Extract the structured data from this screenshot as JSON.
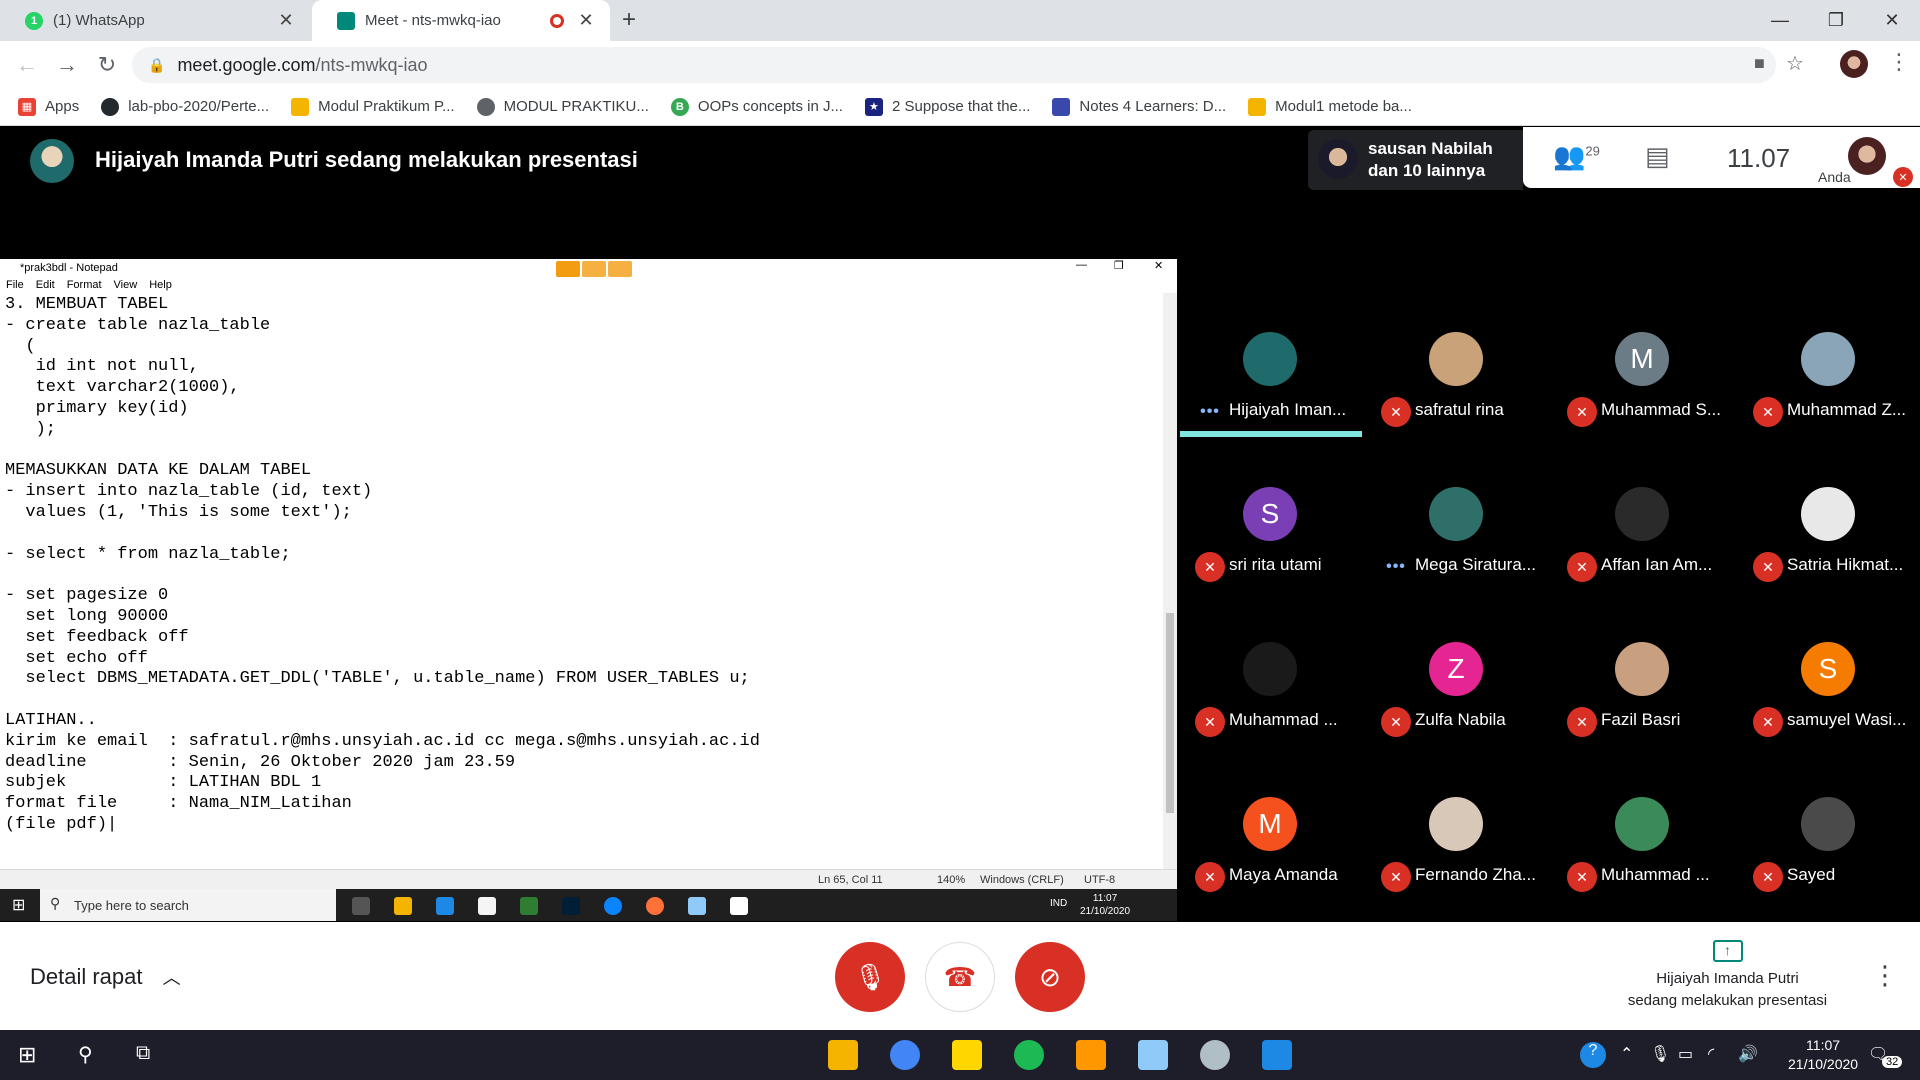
{
  "browser": {
    "tabs": [
      {
        "title": "(1) WhatsApp",
        "badge": "1",
        "active": false
      },
      {
        "title": "Meet - nts-mwkq-iao",
        "active": true
      }
    ],
    "new_tab": "+",
    "url_host": "meet.google.com",
    "url_path": "/nts-mwkq-iao",
    "bookmarks": [
      {
        "label": "Apps",
        "icon": "apps-grid-icon",
        "color": "#ea4335"
      },
      {
        "label": "lab-pbo-2020/Perte...",
        "icon": "github-icon",
        "color": "#24292e"
      },
      {
        "label": "Modul Praktikum P...",
        "icon": "drive-icon",
        "color": "#f4b400"
      },
      {
        "label": "MODUL PRAKTIKU...",
        "icon": "globe-icon",
        "color": "#5f6368"
      },
      {
        "label": "OOPs concepts in J...",
        "icon": "b-icon",
        "color": "#34a853"
      },
      {
        "label": "2 Suppose that the...",
        "icon": "star-badge-icon",
        "color": "#1a237e"
      },
      {
        "label": "Notes 4 Learners: D...",
        "icon": "notes-icon",
        "color": "#3949ab"
      },
      {
        "label": "Modul1 metode ba...",
        "icon": "drive-icon",
        "color": "#f4b400"
      }
    ]
  },
  "meet": {
    "presenter_banner": "Hijaiyah Imanda Putri sedang melakukan presentasi",
    "speaker_line1": "sausan Nabilah",
    "speaker_line2": "dan 10 lainnya",
    "participant_count": "29",
    "time": "11.07",
    "you_label": "Anda",
    "details_label": "Detail rapat",
    "present_line1": "Hijaiyah Imanda Putri",
    "present_line2": "sedang melakukan presentasi",
    "participants": [
      {
        "name": "Hijaiyah Iman...",
        "status": "speaking",
        "avatar": "photo",
        "color": "#1f6b6b"
      },
      {
        "name": "safratul rina",
        "status": "muted",
        "avatar": "photo",
        "color": "#c9a27a"
      },
      {
        "name": "Muhammad S...",
        "status": "muted",
        "avatar": "M",
        "color": "#6b7c87"
      },
      {
        "name": "Muhammad Z...",
        "status": "muted",
        "avatar": "photo",
        "color": "#8aa5b8"
      },
      {
        "name": "sri rita utami",
        "status": "muted",
        "avatar": "S",
        "color": "#7b3fb5"
      },
      {
        "name": "Mega Siratura...",
        "status": "speaking",
        "avatar": "photo",
        "color": "#2f6f6a"
      },
      {
        "name": "Affan Ian Am...",
        "status": "muted",
        "avatar": "photo",
        "color": "#2a2a2a"
      },
      {
        "name": "Satria Hikmat...",
        "status": "muted",
        "avatar": "photo",
        "color": "#e8e8e8"
      },
      {
        "name": "Muhammad ...",
        "status": "muted",
        "avatar": "photo",
        "color": "#1a1a1a"
      },
      {
        "name": "Zulfa Nabila",
        "status": "muted",
        "avatar": "Z",
        "color": "#e52592"
      },
      {
        "name": "Fazil Basri",
        "status": "muted",
        "avatar": "photo",
        "color": "#c8a080"
      },
      {
        "name": "samuyel Wasi...",
        "status": "muted",
        "avatar": "S",
        "color": "#f57c00"
      },
      {
        "name": "Maya Amanda",
        "status": "muted",
        "avatar": "M",
        "color": "#f4511e"
      },
      {
        "name": "Fernando Zha...",
        "status": "muted",
        "avatar": "photo",
        "color": "#d8c8b8"
      },
      {
        "name": "Muhammad ...",
        "status": "muted",
        "avatar": "photo",
        "color": "#3a8a5a"
      },
      {
        "name": "Sayed",
        "status": "muted",
        "avatar": "photo",
        "color": "#4a4a4a"
      }
    ]
  },
  "notepad": {
    "title": "*prak3bdl - Notepad",
    "menu": [
      "File",
      "Edit",
      "Format",
      "View",
      "Help"
    ],
    "content": "3. MEMBUAT TABEL\n- create table nazla_table\n  (\n   id int not null,\n   text varchar2(1000),\n   primary key(id)\n   );\n\nMEMASUKKAN DATA KE DALAM TABEL\n- insert into nazla_table (id, text)\n  values (1, 'This is some text');\n\n- select * from nazla_table;\n\n- set pagesize 0\n  set long 90000\n  set feedback off\n  set echo off\n  select DBMS_METADATA.GET_DDL('TABLE', u.table_name) FROM USER_TABLES u;\n\nLATIHAN..\nkirim ke email  : safratul.r@mhs.unsyiah.ac.id cc mega.s@mhs.unsyiah.ac.id\ndeadline        : Senin, 26 Oktober 2020 jam 23.59\nsubjek          : LATIHAN BDL 1\nformat file     : Nama_NIM_Latihan\n(file pdf)|",
    "status_pos": "Ln 65, Col 11",
    "status_zoom": "140%",
    "status_eol": "Windows (CRLF)",
    "status_enc": "UTF-8",
    "inner_search": "Type here to search",
    "inner_lang": "IND",
    "inner_time": "11:07",
    "inner_date": "21/10/2020"
  },
  "taskbar": {
    "time": "11:07",
    "date": "21/10/2020",
    "notif_count": "32"
  }
}
